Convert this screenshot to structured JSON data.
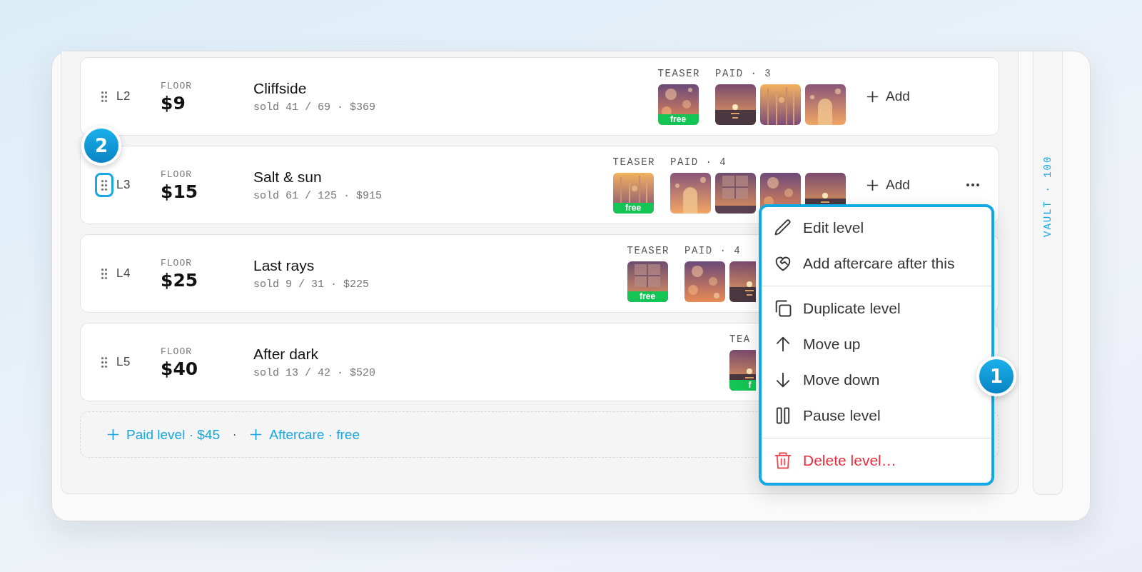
{
  "rows": [
    {
      "code": "L2",
      "handle_highlighted": false,
      "hovered": false,
      "floor_label": "FLOOR",
      "price": "$9",
      "title": "Cliffside",
      "stats": "sold 41 / 69 · $369",
      "teaser": {
        "label": "TEASER",
        "thumb": {
          "kind": "picture",
          "badge": "free"
        }
      },
      "paid": {
        "label": "PAID · 3"
      },
      "add_label": "Add"
    },
    {
      "code": "L3",
      "handle_highlighted": true,
      "hovered": true,
      "floor_label": "FLOOR",
      "price": "$15",
      "title": "Salt & sun",
      "stats": "sold 61 / 125 · $915",
      "teaser": {
        "label": "TEASER",
        "thumb": {
          "kind": "picture",
          "badge": "free"
        }
      },
      "paid": {
        "label": "PAID · 4"
      },
      "add_label": "Add"
    },
    {
      "code": "L4",
      "handle_highlighted": false,
      "hovered": false,
      "floor_label": "FLOOR",
      "price": "$25",
      "title": "Last rays",
      "stats": "sold 9 / 31 · $225",
      "teaser": {
        "label": "TEASER",
        "thumb": {
          "kind": "picture",
          "badge": "free"
        }
      },
      "paid": {
        "label": "PAID · 4"
      }
    },
    {
      "code": "L5",
      "handle_highlighted": false,
      "hovered": false,
      "floor_label": "FLOOR",
      "price": "$40",
      "title": "After dark",
      "stats": "sold 13 / 42 · $520",
      "teaser": {
        "label": "TEA",
        "thumb": {
          "kind": "picture",
          "badge": "f"
        }
      }
    }
  ],
  "add_bar": {
    "links": [
      {
        "label": "Paid level · $45"
      },
      {
        "label": "Aftercare · free"
      }
    ],
    "separator": "·"
  },
  "vault": {
    "label": "VAULT · 100"
  },
  "menu": {
    "groups": [
      [
        {
          "label": "Edit level",
          "kind": "normal"
        },
        {
          "label": "Add aftercare after this",
          "kind": "normal"
        }
      ],
      [
        {
          "label": "Duplicate level",
          "kind": "normal"
        },
        {
          "label": "Move up",
          "kind": "normal"
        },
        {
          "label": "Move down",
          "kind": "normal"
        },
        {
          "label": "Pause level",
          "kind": "normal"
        }
      ],
      [
        {
          "label": "Delete level…",
          "kind": "danger"
        }
      ]
    ]
  },
  "annotations": [
    {
      "label": "1"
    },
    {
      "label": "2"
    }
  ]
}
